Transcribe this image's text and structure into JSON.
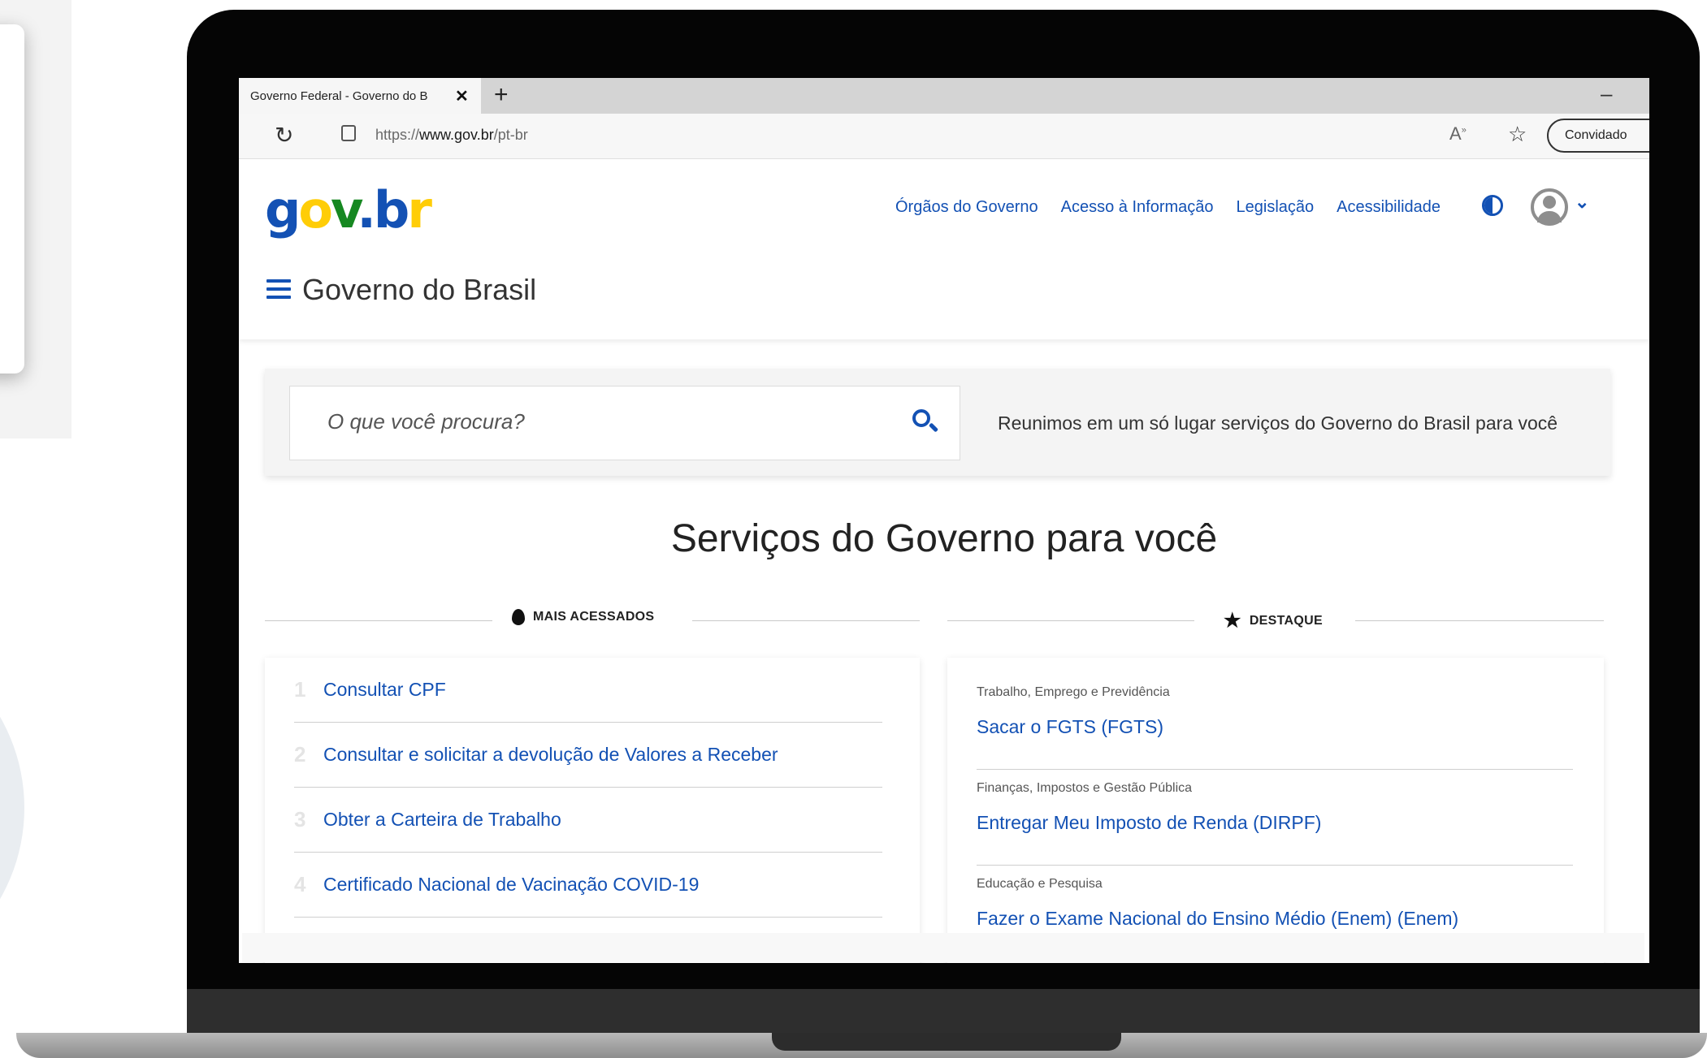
{
  "browser": {
    "tab_title": "Governo Federal - Governo do B",
    "tab_close": "✕",
    "new_tab": "+",
    "minimize": "–",
    "url_prefix": "https://",
    "url_host": "www.gov.br",
    "url_path": "/pt-br",
    "profile_label": "Convidado"
  },
  "site": {
    "logo": {
      "g": "g",
      "o": "o",
      "v": "v",
      "dot": ".",
      "b": "b",
      "r": "r"
    },
    "nav": [
      "Órgãos do Governo",
      "Acesso à Informação",
      "Legislação",
      "Acessibilidade"
    ],
    "title": "Governo do Brasil",
    "search_placeholder": "O que você procura?",
    "tagline": "Reunimos em um só lugar serviços do Governo do Brasil para você",
    "section_title": "Serviços do Governo para você",
    "most_accessed_label": "MAIS ACESSADOS",
    "highlight_label": "DESTAQUE",
    "most_accessed": [
      {
        "num": "1",
        "label": "Consultar CPF"
      },
      {
        "num": "2",
        "label": "Consultar e solicitar a devolução de Valores a Receber"
      },
      {
        "num": "3",
        "label": "Obter a Carteira de Trabalho"
      },
      {
        "num": "4",
        "label": "Certificado Nacional de Vacinação COVID-19"
      }
    ],
    "highlights": [
      {
        "category": "Trabalho, Emprego e Previdência",
        "title": "Sacar o FGTS (FGTS)"
      },
      {
        "category": "Finanças, Impostos e Gestão Pública",
        "title": "Entregar Meu Imposto de Renda (DIRPF)"
      },
      {
        "category": "Educação e Pesquisa",
        "title": "Fazer o Exame Nacional do Ensino Médio (Enem) (Enem)"
      }
    ]
  },
  "colors": {
    "brand_blue": "#1351b4",
    "brand_yellow": "#ffcd07",
    "brand_green": "#168821"
  }
}
